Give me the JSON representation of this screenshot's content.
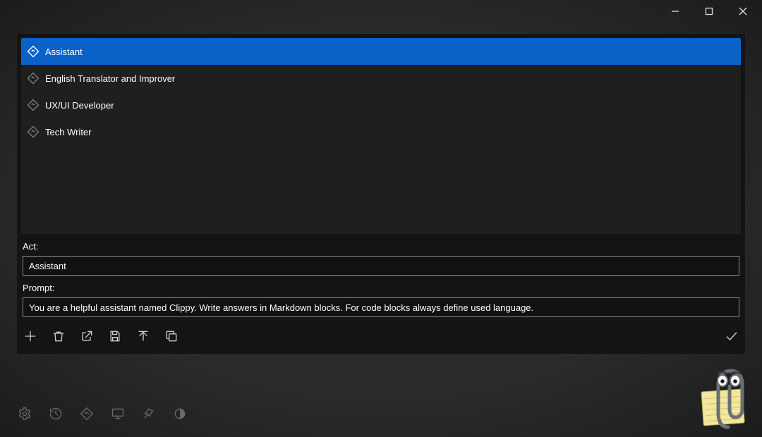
{
  "window": {
    "minimize_icon": "minimize",
    "maximize_icon": "maximize",
    "close_icon": "close"
  },
  "list": {
    "items": [
      {
        "label": "Assistant",
        "selected": true
      },
      {
        "label": "English Translator and Improver",
        "selected": false
      },
      {
        "label": "UX/UI Developer",
        "selected": false
      },
      {
        "label": "Tech Writer",
        "selected": false
      }
    ]
  },
  "form": {
    "act_label": "Act:",
    "act_value": "Assistant",
    "prompt_label": "Prompt:",
    "prompt_value": "You are a helpful assistant named Clippy. Write answers in Markdown blocks. For code blocks always define used language."
  },
  "toolbar": {
    "add": "Add",
    "delete": "Delete",
    "open_external": "Open",
    "save": "Save",
    "upload": "Upload",
    "copy": "Copy",
    "confirm": "Confirm"
  },
  "bottombar": {
    "settings": "Settings",
    "history": "History",
    "prompts": "Prompts",
    "monitor": "Monitor",
    "pin": "Pin",
    "theme": "Theme"
  }
}
